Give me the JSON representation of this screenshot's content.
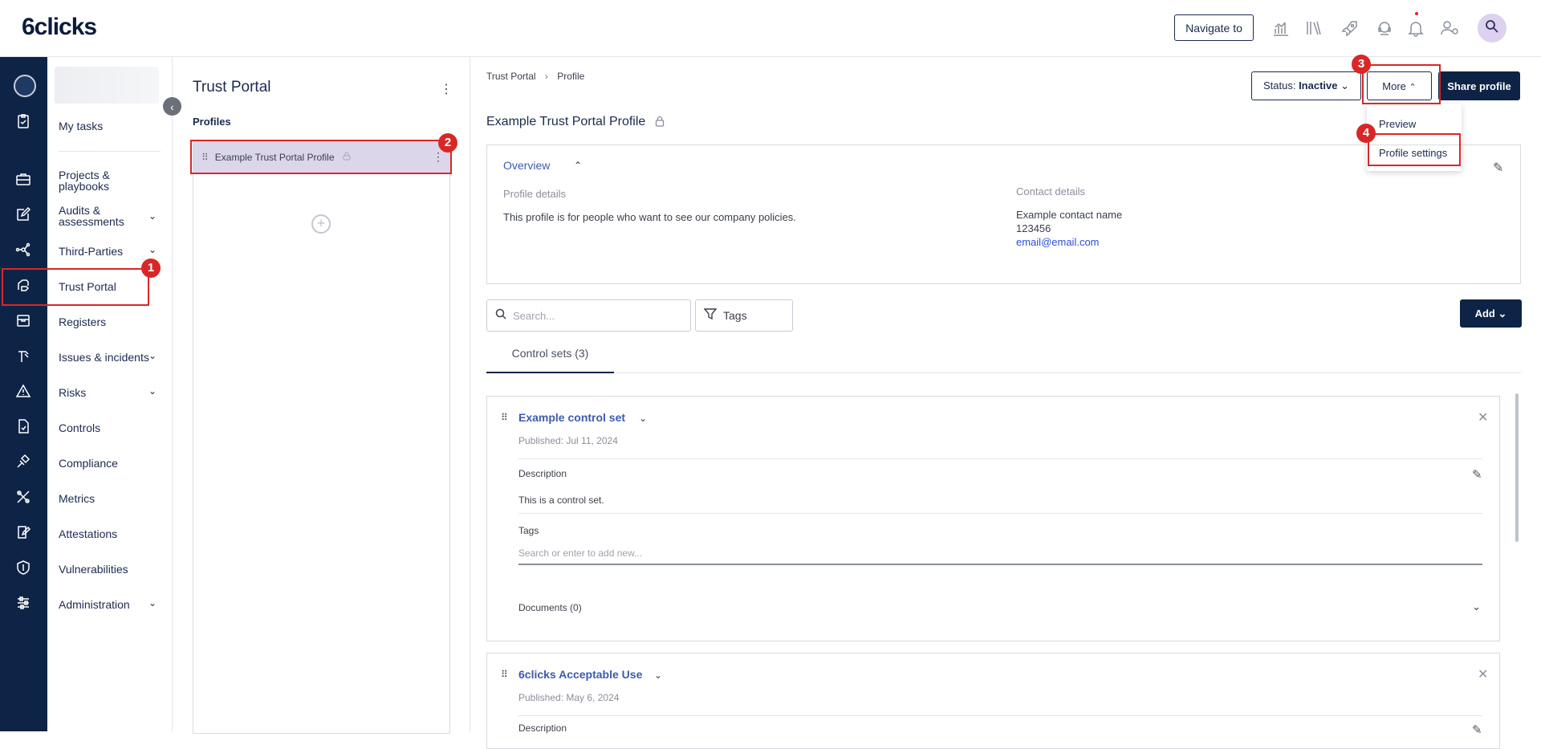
{
  "app": {
    "logo": "6clicks"
  },
  "topbar": {
    "navigate_label": "Navigate to",
    "icons": [
      "analytics-icon",
      "library-icon",
      "rocket-icon",
      "support-icon",
      "bell-icon",
      "user-settings-icon",
      "avatar-search-icon"
    ]
  },
  "sidebar": {
    "items": [
      {
        "label": "My tasks",
        "has_chevron": false
      },
      {
        "label": "Projects & playbooks",
        "has_chevron": false
      },
      {
        "label": "Audits & assessments",
        "has_chevron": true
      },
      {
        "label": "Third-Parties",
        "has_chevron": true
      },
      {
        "label": "Trust Portal",
        "has_chevron": false,
        "active": true
      },
      {
        "label": "Registers",
        "has_chevron": false
      },
      {
        "label": "Issues & incidents",
        "has_chevron": true
      },
      {
        "label": "Risks",
        "has_chevron": true
      },
      {
        "label": "Controls",
        "has_chevron": false
      },
      {
        "label": "Compliance",
        "has_chevron": false
      },
      {
        "label": "Metrics",
        "has_chevron": false
      },
      {
        "label": "Attestations",
        "has_chevron": false
      },
      {
        "label": "Vulnerabilities",
        "has_chevron": false
      },
      {
        "label": "Administration",
        "has_chevron": true
      }
    ]
  },
  "profiles_panel": {
    "title": "Trust Portal",
    "subtitle": "Profiles",
    "items": [
      {
        "label": "Example Trust Portal Profile"
      }
    ]
  },
  "breadcrumb": {
    "root": "Trust Portal",
    "separator": "›",
    "current": "Profile"
  },
  "header": {
    "status_prefix": "Status: ",
    "status_value": "Inactive",
    "more_label": "More",
    "share_label": "Share profile",
    "more_menu": [
      "Preview",
      "Profile settings"
    ]
  },
  "page": {
    "title": "Example Trust Portal Profile"
  },
  "overview": {
    "title": "Overview",
    "profile_details_label": "Profile details",
    "profile_details_text": "This profile is for people who want to see our company policies.",
    "contact_label": "Contact details",
    "contact_name": "Example contact name",
    "contact_phone": "123456",
    "contact_email": "email@email.com"
  },
  "toolbar": {
    "search_placeholder": "Search...",
    "tags_label": "Tags",
    "add_label": "Add"
  },
  "tabs": [
    {
      "label": "Control sets (3)"
    }
  ],
  "control_sets": [
    {
      "title": "Example control set",
      "published": "Published: Jul 11, 2024",
      "description_label": "Description",
      "description": "This is a control set.",
      "tags_label": "Tags",
      "tags_placeholder": "Search or enter to add new...",
      "documents_label": "Documents (0)"
    },
    {
      "title": "6clicks Acceptable Use",
      "published": "Published: May 6, 2024",
      "description_label": "Description"
    }
  ],
  "annotations": [
    "1",
    "2",
    "3",
    "4"
  ],
  "colors": {
    "rail": "#0e2446",
    "accent": "#3b5bb0",
    "highlight": "#d92727",
    "selected_row": "#dcd6ea"
  }
}
